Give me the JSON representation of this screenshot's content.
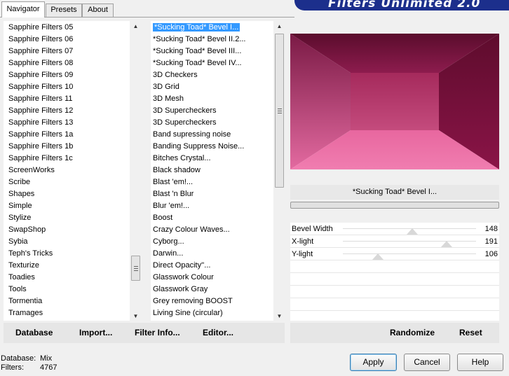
{
  "tabs": [
    "Navigator",
    "Presets",
    "About"
  ],
  "banner": {
    "title": "Filters Unlimited 2.0"
  },
  "categories": [
    "Sapphire Filters 05",
    "Sapphire Filters 06",
    "Sapphire Filters 07",
    "Sapphire Filters 08",
    "Sapphire Filters 09",
    "Sapphire Filters 10",
    "Sapphire Filters 11",
    "Sapphire Filters 12",
    "Sapphire Filters 13",
    "Sapphire Filters 1a",
    "Sapphire Filters 1b",
    "Sapphire Filters 1c",
    "ScreenWorks",
    "Scribe",
    "Shapes",
    "Simple",
    "Stylize",
    "SwapShop",
    "Sybia",
    "Teph's Tricks",
    "Texturize",
    "Toadies",
    "Tools",
    "Tormentia",
    "Tramages"
  ],
  "filters": [
    "*Sucking Toad*  Bevel I...",
    "*Sucking Toad*  Bevel II.2...",
    "*Sucking Toad*  Bevel III...",
    "*Sucking Toad*  Bevel IV...",
    "3D Checkers",
    "3D Grid",
    "3D Mesh",
    "3D Supercheckers",
    "3D Supercheckers",
    "Band supressing noise",
    "Banding Suppress Noise...",
    "Bitches Crystal...",
    "Black shadow",
    "Blast 'em!...",
    "Blast 'n Blur",
    "Blur 'em!...",
    "Boost",
    "Crazy Colour Waves...",
    "Cyborg...",
    "Darwin...",
    "Direct Opacity''...",
    "Glasswork Colour",
    "Glasswork Gray",
    "Grey removing BOOST",
    "Living Sine (circular)"
  ],
  "selected_filter_label": "*Sucking Toad*  Bevel I...",
  "params": [
    {
      "label": "Bevel Width",
      "value": "148"
    },
    {
      "label": "X-light",
      "value": "191"
    },
    {
      "label": "Y-light",
      "value": "106"
    }
  ],
  "bottom_links": {
    "database": "Database",
    "import": "Import...",
    "filter_info": "Filter Info...",
    "editor": "Editor...",
    "randomize": "Randomize",
    "reset": "Reset"
  },
  "status": {
    "database_label": "Database:",
    "database_value": "Mix",
    "filters_label": "Filters:",
    "filters_value": "4767"
  },
  "buttons": {
    "apply": "Apply",
    "cancel": "Cancel",
    "help": "Help"
  },
  "colors": {
    "banner": "#1c2f8c",
    "selection": "#3399ff",
    "preview_top": "#7a1040",
    "preview_bottom": "#ea6fa6"
  }
}
